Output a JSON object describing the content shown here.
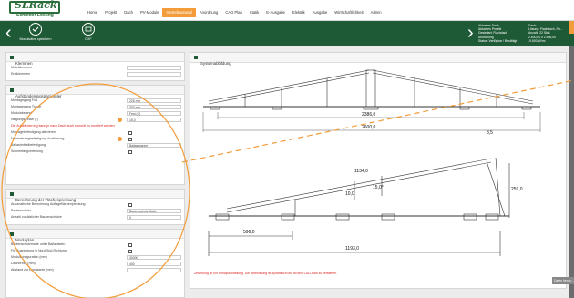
{
  "logo": {
    "text": "SLRack",
    "sub": "Schletter Lösung"
  },
  "nav": [
    "Home",
    "Projekt",
    "Dach",
    "PV-Module",
    "Gestellauswahl",
    "Anordnung",
    "CAD Plan",
    "Statik",
    "E-Ausgabe",
    "Elektrik",
    "Ausgabe",
    "Wirtschaftlichkeit",
    "Admin"
  ],
  "nav_active_index": 4,
  "toolbar": {
    "btn1": "Modulsätze speichern",
    "btn2": "DXF"
  },
  "info_left": [
    "Aktuelles Dach",
    "Aktuelles Projekt",
    "Gestellart: Flachdach",
    "Anordnung",
    "Status: Verfügbar / Bestätigt"
  ],
  "info_right": [
    "Dach: 1",
    "Lösung: Flachdach, Str...",
    "Anzahl: 22 Stck",
    "2.600,00 x 2.596,00",
    "-9.600 W/m²"
  ],
  "sections": {
    "klemmen": {
      "title": "Klemmen",
      "rows": [
        "Mittelklemmen",
        "Endklemmen"
      ]
    },
    "aufstaender": {
      "title": "Aufständerungsparameter",
      "rows": [
        {
          "label": "Montagegang Fuß",
          "value": "225 mm"
        },
        {
          "label": "Montagegang Traufe",
          "value": "300 mm"
        },
        {
          "label": "Modulabstand",
          "value": "Fest (C)"
        },
        {
          "label": "Neigungswinkel (°)",
          "value": "15,0"
        }
      ],
      "warning": "Die Aufständerung kann je nach Dach auch sinnvoll zu montiert werden.",
      "checks": [
        "Montagebefestigung aktivieren",
        "Nebenstrangbefestigung Ausführung"
      ],
      "select_label": "Ballastmittelbefestigung",
      "select_value": "Ballastwanne",
      "last_row": "Schneefangverteilung"
    },
    "flaechen": {
      "title": "Berechnung der Flächenpressung",
      "rows": [
        {
          "label": "Automatische Berechnung Auflageflächenpressung",
          "value": ""
        },
        {
          "label": "Bautenschutz",
          "value": "Bautenschutz Matte"
        },
        {
          "label": "Anzahl zusätzlicher Bautenschutze",
          "value": "0"
        }
      ]
    },
    "modulplan": {
      "title": "Modulplan",
      "rows": [
        {
          "label": "Bautenschutzmatte unter Ballaststein",
          "value": ""
        },
        {
          "label": "Für Ausrichtung in Nord-Süd-Richtung",
          "value": ""
        },
        {
          "label": "Modulkonfiguration (mm)",
          "value": "30000"
        },
        {
          "label": "Dachbreite (mm)",
          "value": "400"
        },
        {
          "label": "Abstand zur Dachkante (mm)",
          "value": ""
        }
      ]
    }
  },
  "drawing": {
    "title": "Systemabbildung",
    "dims_top": [
      "2386,0",
      "2600,0"
    ],
    "dims_bottom": [
      "8,5",
      "1134,0",
      "10,0",
      "15,0°",
      "259,0",
      "596,0",
      "1193,0"
    ],
    "note": "Zeichnung ist nur Prinzipdarstellung. Die Berechnung ist dynamisch und ist kein CAD-Plan zu verstehen."
  },
  "side_button": "Daten herun..."
}
